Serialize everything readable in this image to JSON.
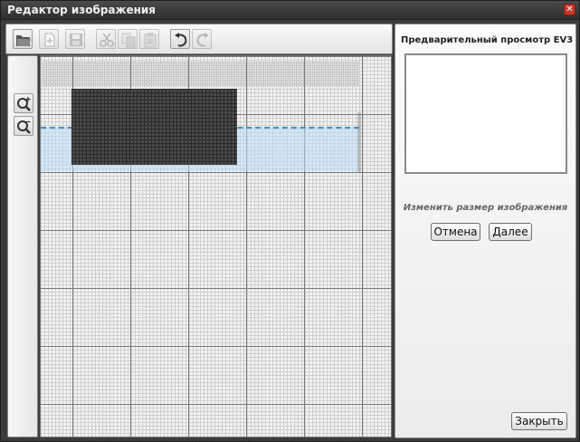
{
  "window": {
    "title": "Редактор изображения",
    "close_glyph": "✕"
  },
  "toolbar": {
    "buttons": [
      {
        "name": "open-icon",
        "enabled": true
      },
      {
        "name": "new-icon",
        "enabled": false
      },
      {
        "name": "save-icon",
        "enabled": false
      },
      {
        "name": "cut-icon",
        "enabled": false
      },
      {
        "name": "copy-icon",
        "enabled": false
      },
      {
        "name": "paste-icon",
        "enabled": false
      },
      {
        "name": "undo-icon",
        "enabled": true
      },
      {
        "name": "redo-icon",
        "enabled": false
      }
    ]
  },
  "zoom": {
    "in_icon": "zoom-in-icon",
    "out_icon": "zoom-out-icon"
  },
  "right_panel": {
    "preview_title": "Предварительный просмотр EV3",
    "resize_label": "Изменить размер изображения",
    "cancel_label": "Отмена",
    "next_label": "Далее",
    "close_label": "Закрыть"
  },
  "colors": {
    "selection_dash": "#3a93c9",
    "title_bar": "#3a3a3a",
    "close_button": "#c43a2a"
  }
}
